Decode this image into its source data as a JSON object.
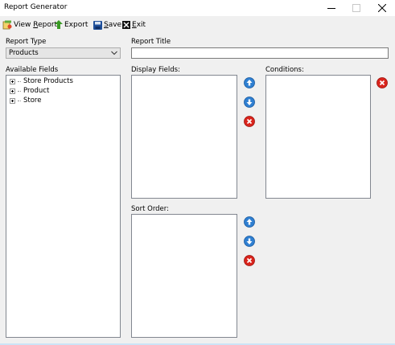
{
  "window": {
    "title": "Report Generator"
  },
  "toolbar": {
    "view_report": {
      "pre": "View ",
      "key": "R",
      "post": "eport",
      "icon": "report-icon"
    },
    "export": {
      "pre": "Export",
      "key": "",
      "post": "",
      "icon": "up-arrow-icon"
    },
    "save": {
      "pre": "",
      "key": "S",
      "post": "ave",
      "icon": "floppy-disk-icon"
    },
    "exit": {
      "pre": "",
      "key": "E",
      "post": "xit",
      "icon": "exit-x-icon"
    }
  },
  "report_type": {
    "label": "Report Type",
    "value": "Products"
  },
  "report_title": {
    "label": "Report Title",
    "value": ""
  },
  "available_fields": {
    "label": "Available Fields",
    "items": [
      "Store Products",
      "Product",
      "Store"
    ]
  },
  "display_fields": {
    "label": "Display Fields:"
  },
  "conditions": {
    "label": "Conditions:"
  },
  "sort_order": {
    "label": "Sort Order:"
  },
  "colors": {
    "blue_button": "#2f7fd1",
    "red_button": "#d9241c",
    "export_green": "#3a9a25",
    "save_blue": "#1f4f9a"
  }
}
